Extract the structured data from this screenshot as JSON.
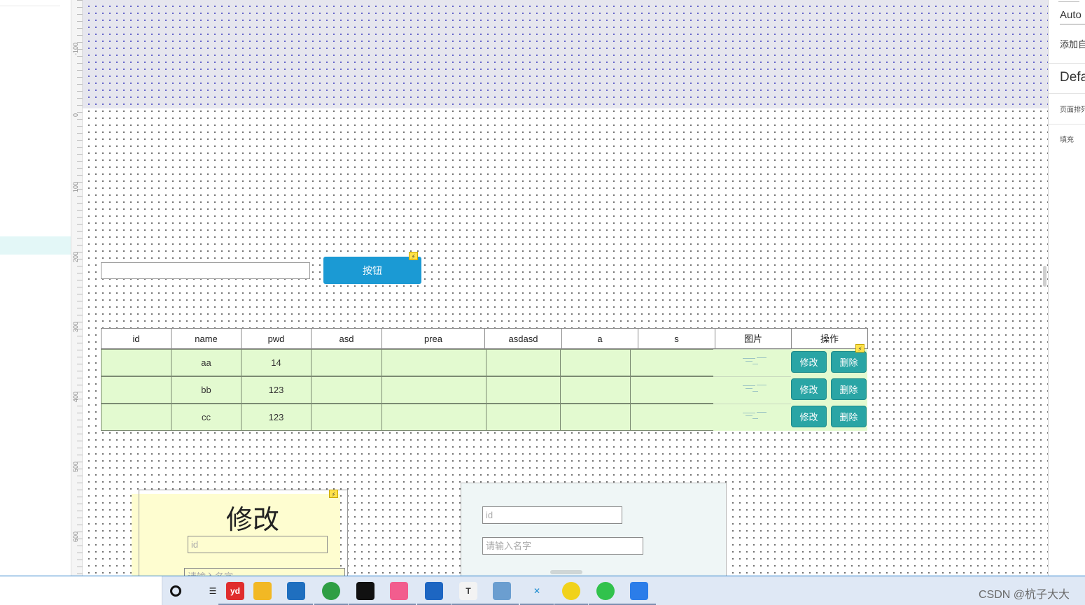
{
  "ruler": {
    "labels": [
      "-100",
      "0",
      "100",
      "200",
      "300",
      "400",
      "500",
      "600"
    ]
  },
  "toolbar": {
    "primary_button_label": "按钮"
  },
  "table": {
    "columns": [
      "id",
      "name",
      "pwd",
      "asd",
      "prea",
      "asdasd",
      "a",
      "s",
      "图片",
      "操作"
    ],
    "rows": [
      {
        "id": "",
        "name": "aa",
        "pwd": "14"
      },
      {
        "id": "",
        "name": "bb",
        "pwd": "123"
      },
      {
        "id": "",
        "name": "cc",
        "pwd": "123"
      }
    ],
    "edit_label": "修改",
    "delete_label": "删除"
  },
  "edit_panel": {
    "title": "修改",
    "id_placeholder": "id",
    "name_placeholder": "请输入名字"
  },
  "add_panel": {
    "id_placeholder": "id",
    "name_placeholder": "请输入名字"
  },
  "right_panel": {
    "auto_value": "Auto",
    "add_label": "添加自",
    "default_label": "Defa",
    "page_label": "页面排列",
    "fill_label": "填充"
  },
  "taskbar": {
    "apps": [
      "cortana-icon",
      "task-view-icon",
      "youdao-icon",
      "file-explorer-icon",
      "mail-icon",
      "chrome-icon",
      "jetbrains-icon",
      "bilibili-icon",
      "remote-desktop-icon",
      "typora-icon",
      "notebook-icon",
      "axure-icon",
      "qq-music-icon",
      "wechat-icon",
      "feishu-icon"
    ],
    "youdao_text": "yd",
    "typora_text": "T",
    "watermark": "CSDN @杭子大大"
  },
  "colors": {
    "accent_blue": "#1b9ad4",
    "table_button": "#2aa5a5",
    "row_green": "#e3fad0",
    "edit_panel_yellow": "#fefdd0"
  }
}
